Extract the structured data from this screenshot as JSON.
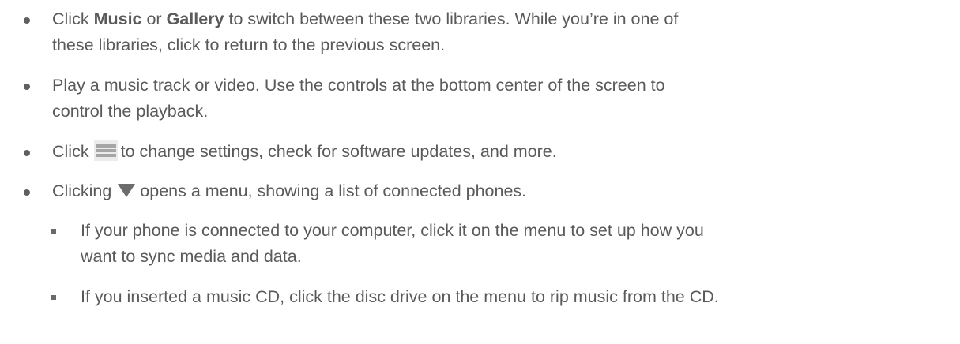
{
  "items": [
    {
      "p1": "Click ",
      "b1": "Music",
      "p2": " or ",
      "b2": "Gallery",
      "p3": " to switch between these two libraries. While you’re in one of",
      "line2": "these libraries, click to return to the previous screen."
    },
    {
      "line1": "Play a music track or video. Use the controls at the bottom center of the screen to",
      "line2": "control the playback."
    },
    {
      "pre": "Click",
      "icon": "menu-icon",
      "post": "to change settings, check for software updates, and more."
    },
    {
      "pre": "Clicking",
      "icon": "dropdown-triangle-icon",
      "post": "opens a menu, showing a list of connected phones."
    }
  ],
  "subitems": [
    {
      "line1": "If your phone is connected to your computer, click it on the menu to set up how you",
      "line2": "want to sync media and data."
    },
    {
      "line1": "If you inserted a music CD, click the disc drive on the menu to rip music from the CD."
    }
  ]
}
